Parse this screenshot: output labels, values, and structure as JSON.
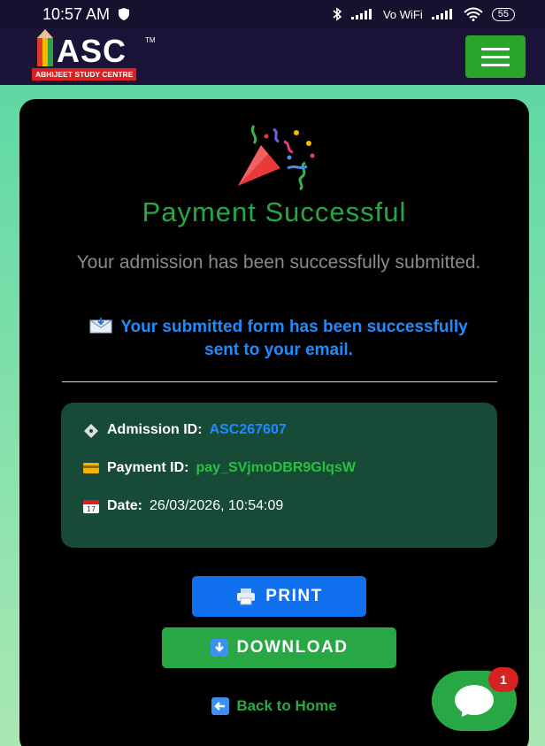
{
  "status_bar": {
    "time": "10:57 AM",
    "network_label": "Vo WiFi",
    "battery": "55"
  },
  "header": {
    "logo_text": "ASC",
    "logo_tm": "TM",
    "logo_subtitle": "ABHIJEET STUDY CENTRE",
    "menu_icon": "hamburger-icon",
    "brand_color": "#29a52a"
  },
  "success": {
    "icon": "party-popper-icon",
    "title": "Payment Successful",
    "subtitle": "Your admission has been successfully submitted.",
    "email_note": "Your submitted form has been successfully sent to your email."
  },
  "details": {
    "admission_label": "Admission ID:",
    "admission_value": "ASC267607",
    "payment_label": "Payment ID:",
    "payment_value": "pay_SVjmoDBR9GlqsW",
    "date_label": "Date:",
    "date_value": "26/03/2026, 10:54:09"
  },
  "actions": {
    "print_label": "PRINT",
    "download_label": "DOWNLOAD",
    "back_label": "Back to Home"
  },
  "chat": {
    "badge_count": "1"
  },
  "colors": {
    "success_green": "#28a745",
    "link_blue": "#1e8cff",
    "print_blue": "#1170ee",
    "panel_green": "#184a38"
  }
}
